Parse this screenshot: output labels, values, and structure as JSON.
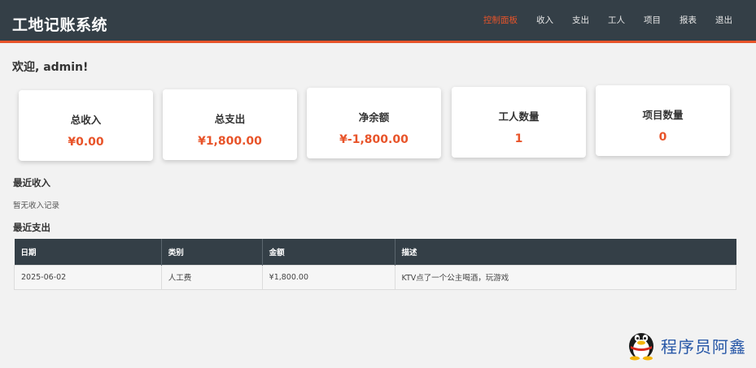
{
  "header": {
    "title": "工地记账系统",
    "nav": [
      "控制面板",
      "收入",
      "支出",
      "工人",
      "项目",
      "报表",
      "退出"
    ],
    "active_index": 0,
    "accent_color": "#e8542a",
    "bar_color": "#343f47"
  },
  "welcome": "欢迎, admin!",
  "cards": [
    {
      "label": "总收入",
      "value": "¥0.00"
    },
    {
      "label": "总支出",
      "value": "¥1,800.00"
    },
    {
      "label": "净余额",
      "value": "¥-1,800.00"
    },
    {
      "label": "工人数量",
      "value": "1"
    },
    {
      "label": "项目数量",
      "value": "0"
    }
  ],
  "income": {
    "title": "最近收入",
    "empty_text": "暂无收入记录"
  },
  "expense": {
    "title": "最近支出",
    "columns": [
      "日期",
      "类别",
      "金额",
      "描述"
    ],
    "rows": [
      [
        "2025-06-02",
        "人工费",
        "¥1,800.00",
        "KTV点了一个公主喝酒，玩游戏"
      ]
    ]
  },
  "watermark": {
    "text": "程序员阿鑫",
    "icon": "penguin-icon"
  }
}
